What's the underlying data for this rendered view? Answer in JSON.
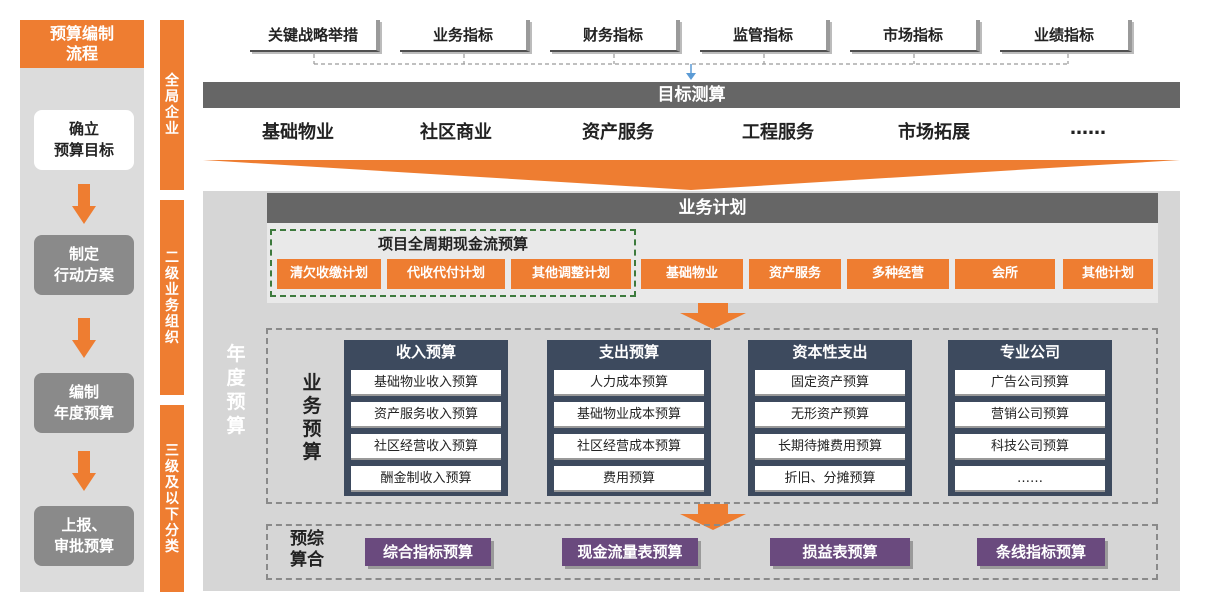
{
  "flow": {
    "title_line1": "预算编制",
    "title_line2": "流程",
    "steps": [
      {
        "line1": "确立",
        "line2": "预算目标"
      },
      {
        "line1": "制定",
        "line2": "行动方案"
      },
      {
        "line1": "编制",
        "line2": "年度预算"
      },
      {
        "line1": "上报、",
        "line2": "审批预算"
      }
    ]
  },
  "levels": [
    {
      "chars": [
        "全",
        "局",
        "企",
        "业"
      ]
    },
    {
      "chars": [
        "二",
        "级",
        "业",
        "务",
        "组",
        "织"
      ]
    },
    {
      "chars": [
        "三",
        "级",
        "及",
        "以",
        "下",
        "分",
        "类"
      ]
    }
  ],
  "indicators": [
    "关键战略举措",
    "业务指标",
    "财务指标",
    "监管指标",
    "市场指标",
    "业绩指标"
  ],
  "target": {
    "title": "目标测算",
    "items": [
      "基础物业",
      "社区商业",
      "资产服务",
      "工程服务",
      "市场拓展",
      "……"
    ]
  },
  "plan": {
    "title": "业务计划",
    "cashflow_title": "项目全周期现金流预算",
    "cashflow_items": [
      "清欠收缴计划",
      "代收代付计划",
      "其他调整计划"
    ],
    "other_items": [
      "基础物业",
      "资产服务",
      "多种经营",
      "会所",
      "其他计划"
    ]
  },
  "annual_label": [
    "年",
    "度",
    "预",
    "算"
  ],
  "business_label": [
    "业",
    "务",
    "预",
    "算"
  ],
  "columns": [
    {
      "title": "收入预算",
      "items": [
        "基础物业收入预算",
        "资产服务收入预算",
        "社区经营收入预算",
        "酬金制收入预算"
      ]
    },
    {
      "title": "支出预算",
      "items": [
        "人力成本预算",
        "基础物业成本预算",
        "社区经营成本预算",
        "费用预算"
      ]
    },
    {
      "title": "资本性支出",
      "items": [
        "固定资产预算",
        "无形资产预算",
        "长期待摊费用预算",
        "折旧、分摊预算"
      ]
    },
    {
      "title": "专业公司",
      "items": [
        "广告公司预算",
        "营销公司预算",
        "科技公司预算",
        "……"
      ]
    }
  ],
  "summary": {
    "label_line1": "预综",
    "label_line2": "算合",
    "items": [
      "综合指标预算",
      "现金流量表预算",
      "损益表预算",
      "条线指标预算"
    ]
  },
  "colors": {
    "orange": "#ee7d31",
    "dark_gray": "#666666",
    "navy": "#3d4a5e",
    "purple": "#6a4a7e"
  }
}
